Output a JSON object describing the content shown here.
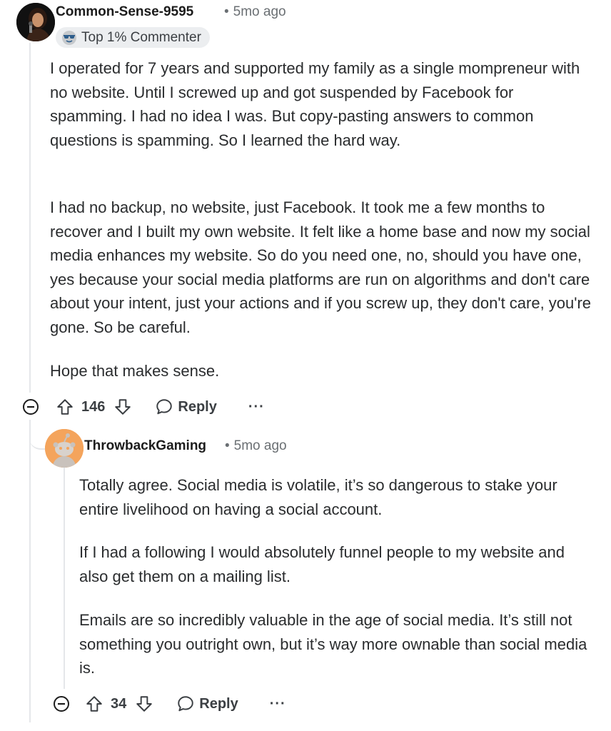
{
  "comment1": {
    "username": "Common-Sense-9595",
    "separator": "•",
    "timestamp": "5mo ago",
    "flair": "Top 1% Commenter",
    "paragraphs": [
      "I operated for 7 years and supported my family as a single mompreneur with no website. Until I screwed up and got suspended by Facebook for spamming. I had no idea I was. But copy-pasting answers to common questions is spamming. So I learned the hard way.",
      "I had no backup, no website, just Facebook. It took me a few months to recover and I built my own website. It felt like a home base and now my social media enhances my website. So do you need one, no, should you have one, yes because your social media platforms are run on algorithms and don't care about your intent, just your actions and if you screw up, they don't care, you're gone. So be careful.",
      "Hope that makes sense."
    ],
    "votes": "146",
    "reply_label": "Reply",
    "more_label": "···"
  },
  "comment2": {
    "username": "ThrowbackGaming",
    "separator": "•",
    "timestamp": "5mo ago",
    "paragraphs": [
      "Totally agree. Social media is volatile, it’s so dangerous to stake your entire livelihood on having a social account.",
      "If I had a following I would absolutely funnel people to my website and also get them on a mailing list.",
      "Emails are so incredibly valuable in the age of social media. It’s still not something you outright own, but it’s way more ownable than social media is."
    ],
    "votes": "34",
    "reply_label": "Reply",
    "more_label": "···"
  },
  "icons": {
    "collapse": "collapse-icon",
    "upvote": "upvote-icon",
    "downvote": "downvote-icon",
    "reply": "reply-bubble-icon",
    "more": "more-icon",
    "flair": "sunglasses-emoji-icon"
  },
  "colors": {
    "text": "#2a2c2e",
    "meta": "#6a6f73",
    "thread": "#e5e7ea",
    "flair_bg": "#eceef0",
    "avatar2_bg": "#f4a45c"
  }
}
